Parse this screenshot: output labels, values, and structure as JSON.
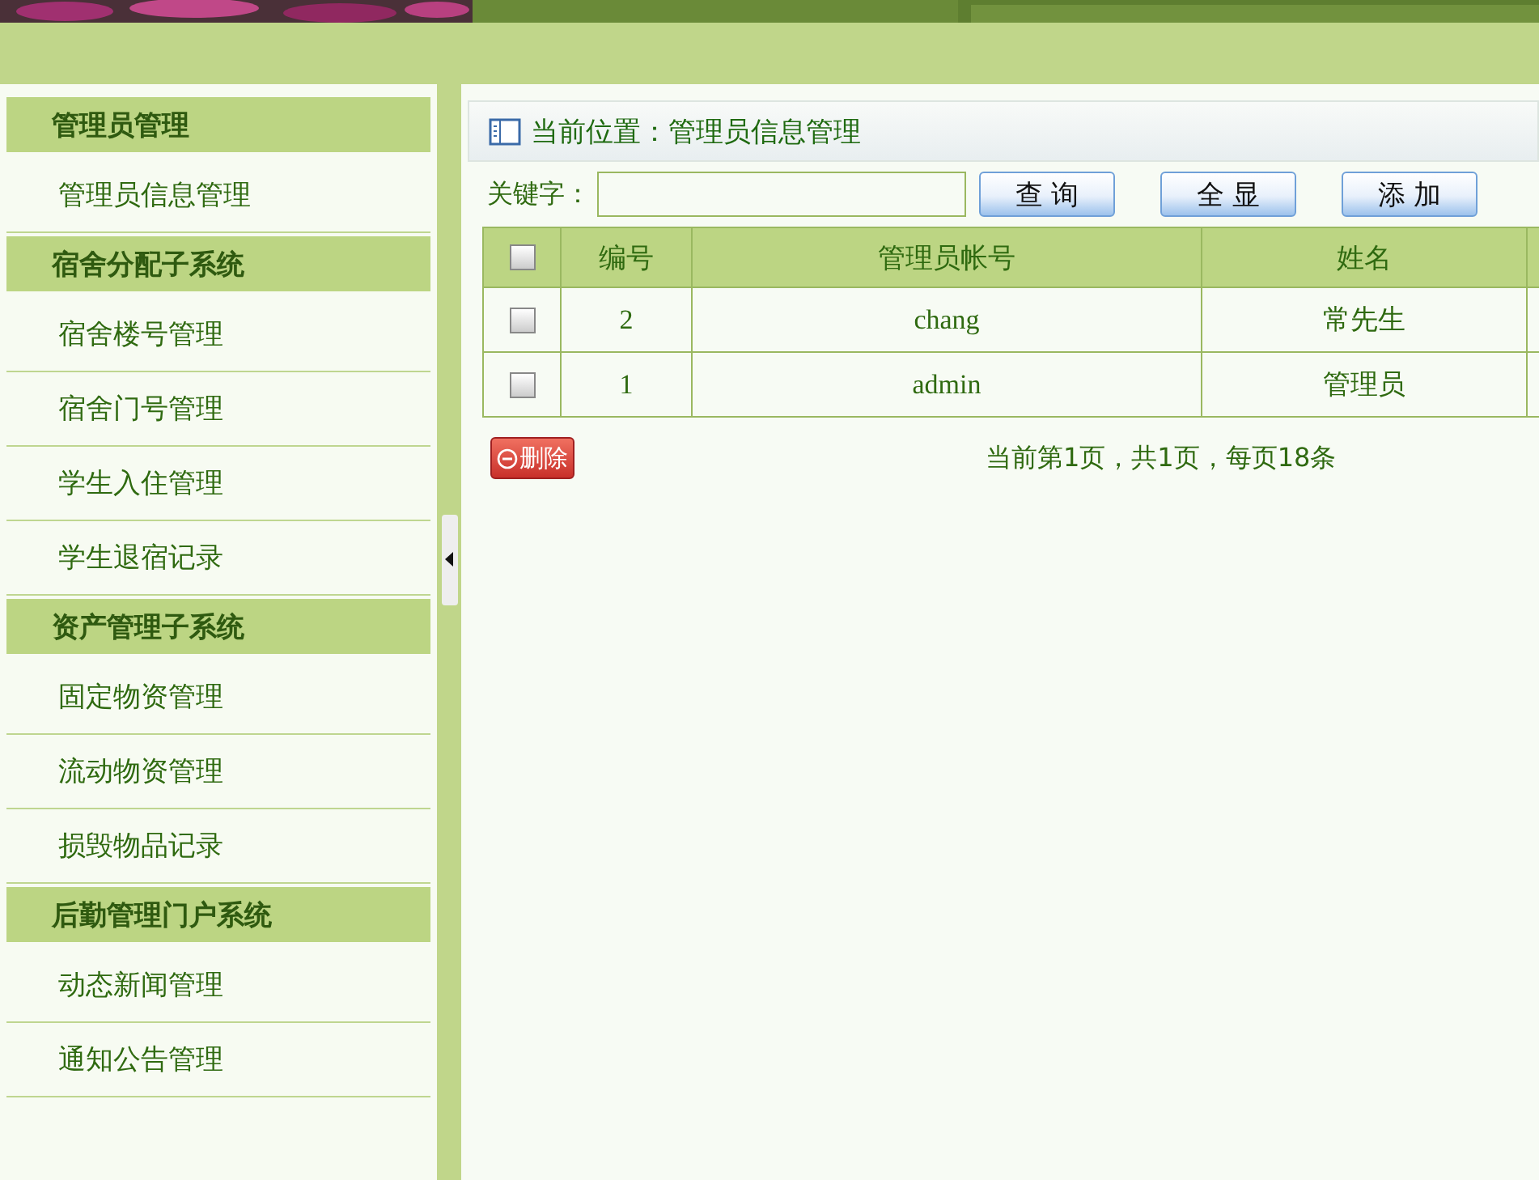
{
  "sidebar": {
    "groups": [
      {
        "title": "管理员管理",
        "items": [
          "管理员信息管理"
        ]
      },
      {
        "title": "宿舍分配子系统",
        "items": [
          "宿舍楼号管理",
          "宿舍门号管理",
          "学生入住管理",
          "学生退宿记录"
        ]
      },
      {
        "title": "资产管理子系统",
        "items": [
          "固定物资管理",
          "流动物资管理",
          "损毁物品记录"
        ]
      },
      {
        "title": "后勤管理门户系统",
        "items": [
          "动态新闻管理",
          "通知公告管理"
        ]
      }
    ]
  },
  "breadcrumb": "当前位置：管理员信息管理",
  "search": {
    "label": "关键字：",
    "buttons": [
      "查 询",
      "全 显",
      "添 加"
    ]
  },
  "table": {
    "select_all_checked": false,
    "columns": [
      "编号",
      "管理员帐号",
      "姓名"
    ],
    "rows": [
      {
        "checked": false,
        "cells": [
          "2",
          "chang",
          "常先生"
        ]
      },
      {
        "checked": false,
        "cells": [
          "1",
          "admin",
          "管理员"
        ]
      }
    ]
  },
  "delete_button": "删除",
  "pagination": "当前第1页，共1页，每页18条"
}
